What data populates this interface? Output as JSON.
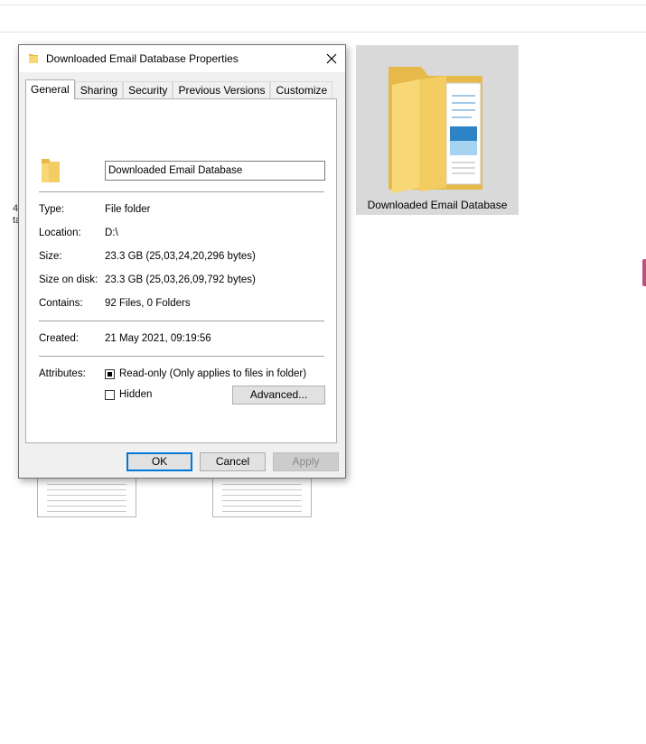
{
  "background": {
    "folder_tile_label": "Downloaded Email Database",
    "clipped_label_line1": "4",
    "clipped_label_line2": "ta"
  },
  "dialog": {
    "title": "Downloaded Email Database Properties",
    "tabs": [
      {
        "label": "General",
        "active": true
      },
      {
        "label": "Sharing",
        "active": false
      },
      {
        "label": "Security",
        "active": false
      },
      {
        "label": "Previous Versions",
        "active": false
      },
      {
        "label": "Customize",
        "active": false
      }
    ],
    "name_value": "Downloaded Email Database",
    "props": {
      "type_label": "Type:",
      "type_value": "File folder",
      "location_label": "Location:",
      "location_value": "D:\\",
      "size_label": "Size:",
      "size_value": "23.3 GB (25,03,24,20,296 bytes)",
      "size_on_disk_label": "Size on disk:",
      "size_on_disk_value": "23.3 GB (25,03,26,09,792 bytes)",
      "contains_label": "Contains:",
      "contains_value": "92 Files, 0 Folders",
      "created_label": "Created:",
      "created_value": "21 May 2021, 09:19:56",
      "attributes_label": "Attributes:"
    },
    "attributes": {
      "readonly_label": "Read-only (Only applies to files in folder)",
      "readonly_state": "indeterminate",
      "hidden_label": "Hidden",
      "hidden_state": "unchecked",
      "advanced_label": "Advanced..."
    },
    "buttons": {
      "ok": "OK",
      "cancel": "Cancel",
      "apply": "Apply"
    }
  },
  "colors": {
    "accent": "#0078d7",
    "folder": "#f8d775",
    "folder_dark": "#e6b94a",
    "tile_selected": "#d9d9d9"
  },
  "icons": [
    "folder-icon",
    "close-icon",
    "checkbox-icon"
  ]
}
